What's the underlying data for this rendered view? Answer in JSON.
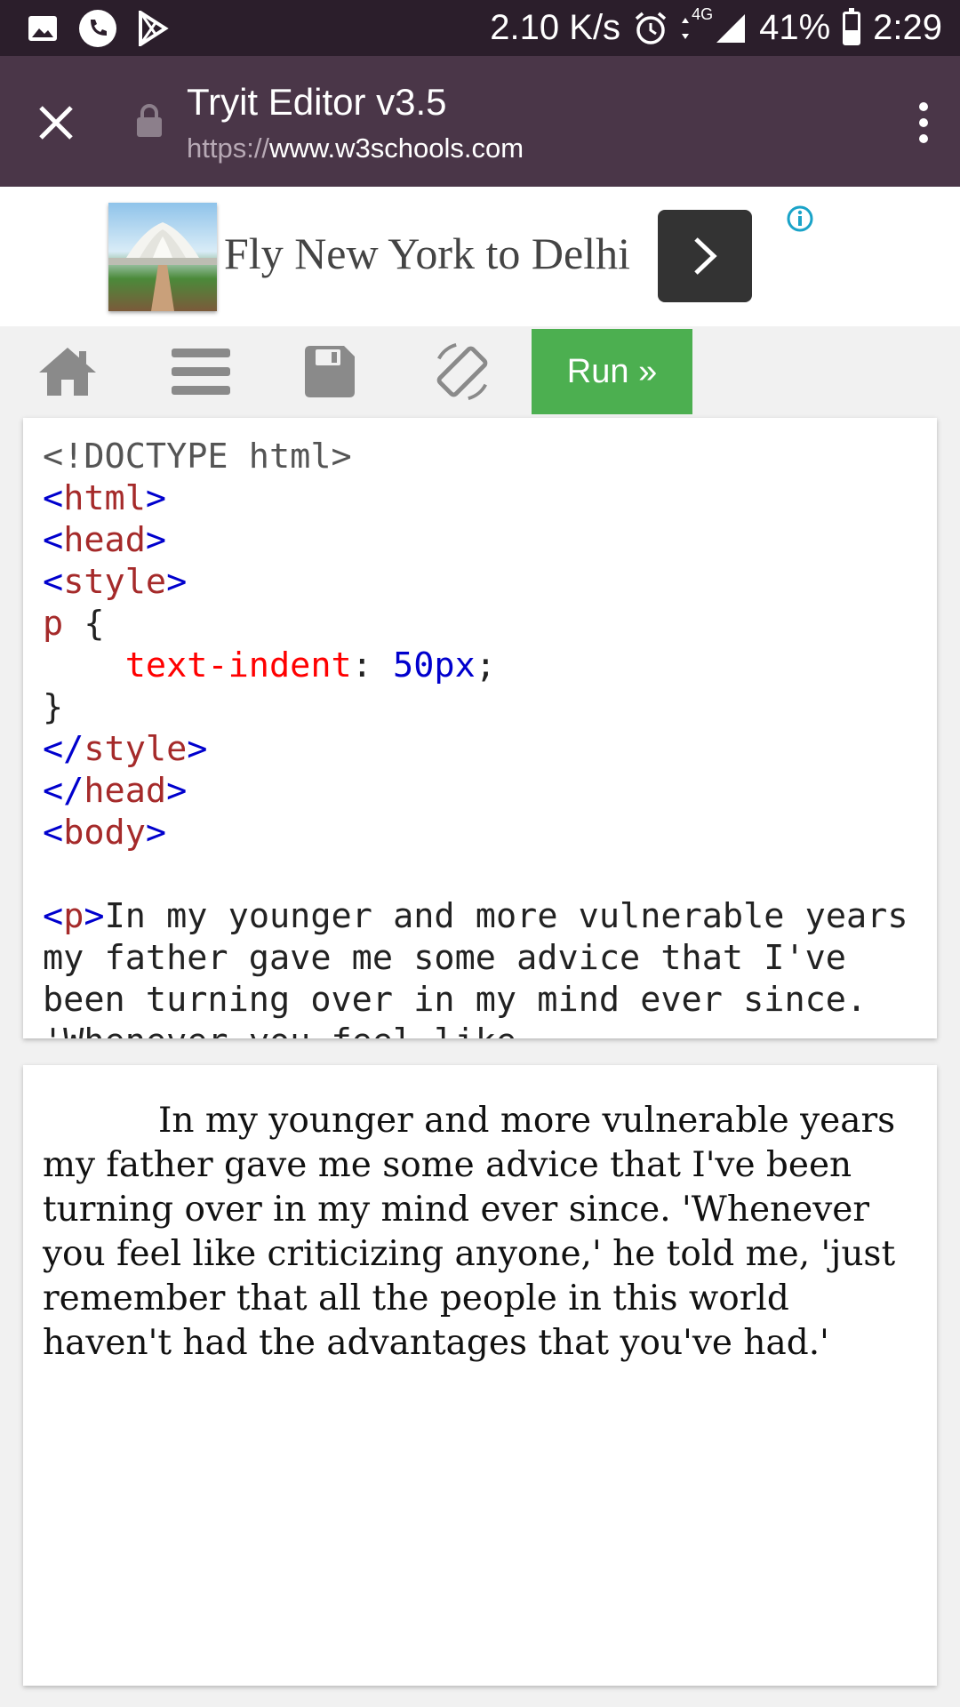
{
  "status_bar": {
    "left_icons": [
      "image-icon",
      "phone-icon",
      "play-store-icon"
    ],
    "net_speed": "2.10 K/s",
    "network": "4G",
    "battery": "41%",
    "battery_level": 0.41,
    "time": "2:29"
  },
  "browser": {
    "title": "Tryit Editor v3.5",
    "url_scheme": "https://",
    "url_host": "www.w3schools.com"
  },
  "ad": {
    "text": "Fly New York to Delhi"
  },
  "toolbar": {
    "icons": [
      "home-icon",
      "menu-icon",
      "save-icon",
      "rotate-icon"
    ],
    "run_label": "Run »"
  },
  "code": {
    "doctype": "<!DOCTYPE html>",
    "lt": "<",
    "lt_slash": "</",
    "gt": ">",
    "tag_html": "html",
    "tag_head": "head",
    "tag_style": "style",
    "tag_body": "body",
    "tag_p": "p",
    "selector": "p",
    "open_brace": " {",
    "indent": "    ",
    "property": "text-indent",
    "colon": ": ",
    "value": "50px",
    "semicolon": ";",
    "close_brace": "}",
    "paragraph_text": "In my younger and more vulnerable years my father gave me some advice that I've been turning over in my mind ever since. 'Whenever you feel like"
  },
  "result": {
    "paragraph": "In my younger and more vulnerable years my father gave me some advice that I've been turning over in my mind ever since. 'Whenever you feel like criticizing anyone,' he told me, 'just remember that all the people in this world haven't had the advantages that you've had.'"
  },
  "colors": {
    "status_bar_bg": "#2b1e2b",
    "app_bar_bg": "#4a3648",
    "run_button": "#4caf50",
    "code_tag": "#a52a2a",
    "code_bracket": "#0000cd",
    "code_property": "#ff0000"
  }
}
